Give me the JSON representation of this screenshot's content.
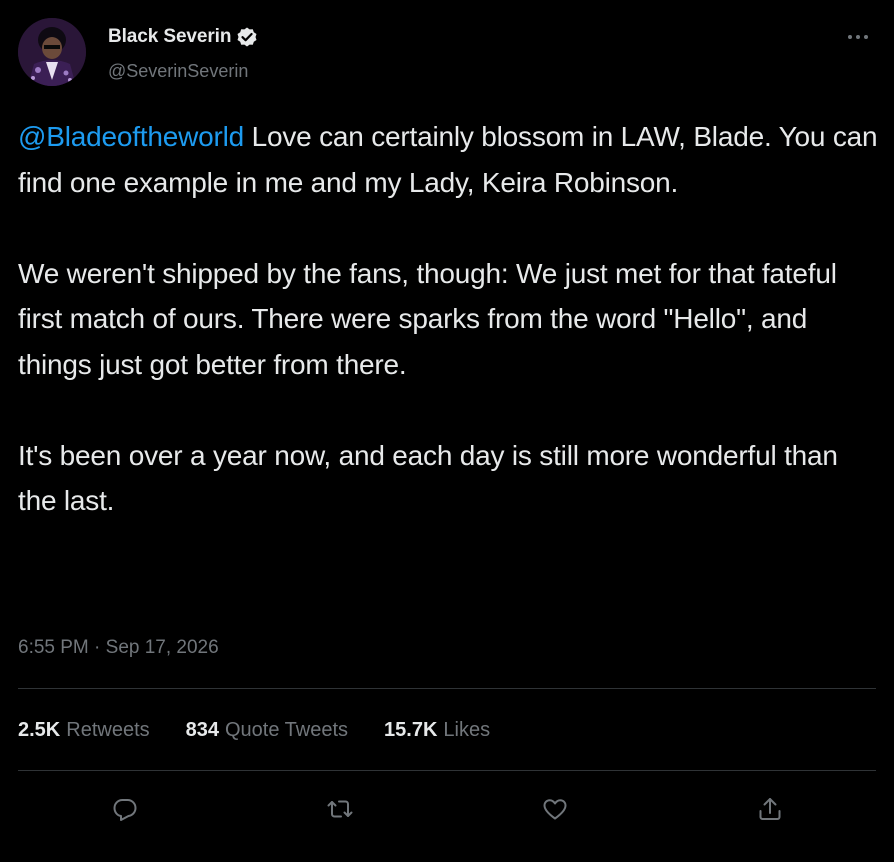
{
  "author": {
    "display_name": "Black Severin",
    "handle": "@SeverinSeverin",
    "verified_icon": "verified-badge-icon",
    "avatar_icon": "avatar"
  },
  "tweet": {
    "mention": "@Bladeoftheworld",
    "text_first_line_rest": " Love can certainly blossom in LAW, Blade. You can find one example in me and my Lady, Keira Robinson.",
    "paragraph_2": "We weren't shipped by the fans, though: We just met for that fateful first match of ours. There were sparks from the word \"Hello\", and things just got better from there.",
    "paragraph_3": "It's been over a year now, and each day is still more wonderful than the last.",
    "timestamp": "6:55 PM · Sep 17, 2026"
  },
  "stats": {
    "retweets_count": "2.5K",
    "retweets_label": "Retweets",
    "quotes_count": "834",
    "quotes_label": "Quote Tweets",
    "likes_count": "15.7K",
    "likes_label": "Likes"
  },
  "actions": {
    "reply_icon": "reply-icon",
    "retweet_icon": "retweet-icon",
    "like_icon": "heart-icon",
    "share_icon": "share-icon",
    "more_icon": "more-icon"
  },
  "colors": {
    "background": "#000000",
    "text": "#e7e9ea",
    "secondary": "#71767b",
    "accent": "#1d9bf0",
    "divider": "#2f3336"
  }
}
